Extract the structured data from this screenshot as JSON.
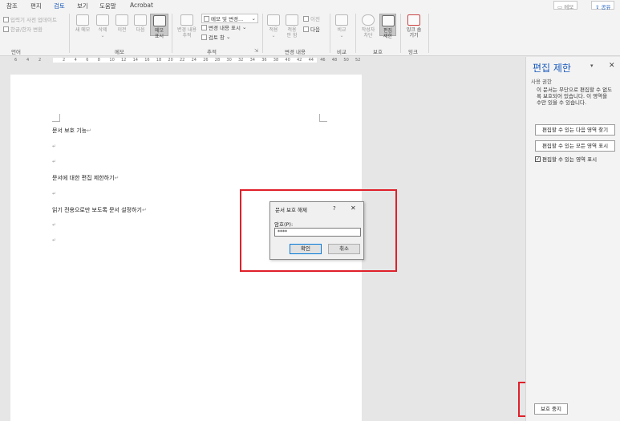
{
  "tabs": [
    "참조",
    "편지",
    "검토",
    "보기",
    "도움말",
    "Acrobat"
  ],
  "active_tab": "검토",
  "top_right": {
    "memo": "메모",
    "share": "공유"
  },
  "ribbon": {
    "language": {
      "items": [
        "입력기 사전 업데이트",
        "한글/한자 변환"
      ],
      "label": "언어"
    },
    "memo": {
      "buttons": [
        "새 메모",
        "삭제",
        "이전",
        "다음"
      ],
      "show": "메모\n표시",
      "label": "메모"
    },
    "tracking": {
      "track_button": "변경 내용\n추적",
      "items": [
        "메모 및 변경...",
        "변경 내용 표시",
        "검토 창"
      ],
      "label": "추적"
    },
    "changes": {
      "accept": "적용",
      "reject": "적용\n안 함",
      "prev": "이전",
      "next": "다음",
      "label": "변경 내용"
    },
    "compare": {
      "button": "비교",
      "label": "비교"
    },
    "protect": {
      "block_authors": "작성자\n차단",
      "restrict": "편집\n제한",
      "label": "보호"
    },
    "ink": {
      "button": "잉크 숨\n기기",
      "label": "잉크"
    }
  },
  "ruler_numbers": [
    "6",
    "4",
    "2",
    "2",
    "4",
    "6",
    "8",
    "10",
    "12",
    "14",
    "16",
    "18",
    "20",
    "22",
    "24",
    "26",
    "28",
    "30",
    "32",
    "34",
    "36",
    "38",
    "40",
    "42",
    "44",
    "46",
    "48",
    "50",
    "52"
  ],
  "document": {
    "lines": [
      "문서 보호 기능",
      "문서에 대한 편집 제한하기",
      "읽기 전용으로만 보도록 문서 설정하기"
    ],
    "mark": "↵"
  },
  "dialog": {
    "title": "문서 보호 해제",
    "help": "?",
    "close": "✕",
    "password_label": "암호(P):",
    "password_value": "****",
    "ok": "확인",
    "cancel": "취소"
  },
  "pane": {
    "title": "편집 제한",
    "dropdown": "▾",
    "close": "✕",
    "subtitle": "사용 권한",
    "message": "이 문서는 무단으로 편집할 수 없도록 보호되어 있습니다. 이 영역을 수만 있을 수 있습니다.",
    "btn_next_region": "편집할 수 있는 다음 영역 찾기",
    "btn_all_regions": "편집할 수 있는 모든 영역 표시",
    "checkbox_label": "편집할 수 있는 영역 표시",
    "checkbox_checked": true,
    "stop_button": "보호 중지"
  },
  "colors": {
    "accent": "#185abd",
    "highlight": "#e0202a"
  }
}
